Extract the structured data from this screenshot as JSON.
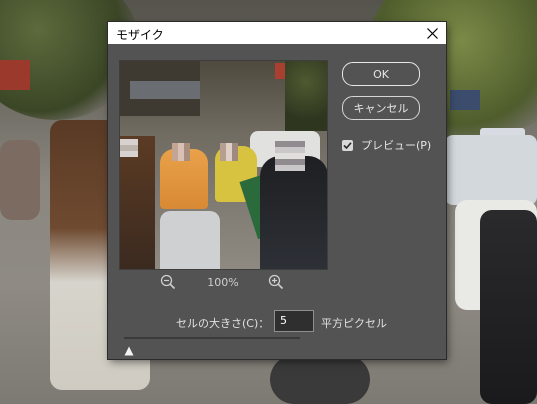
{
  "dialog": {
    "title": "モザイク",
    "buttons": {
      "ok": "OK",
      "cancel": "キャンセル"
    },
    "preview_checkbox": {
      "label": "プレビュー(P)",
      "checked": true
    },
    "zoom": {
      "percent": "100%"
    },
    "cell_size": {
      "label": "セルの大きさ(C)：",
      "value": "5",
      "unit": "平方ピクセル",
      "slider_level": 0.0
    }
  },
  "icons": {
    "close": "close-icon",
    "zoom_out": "zoom-out-icon",
    "zoom_in": "zoom-in-icon",
    "checkmark": "checkmark-icon"
  },
  "colors": {
    "dialog_bg": "#535353",
    "titlebar_bg": "#ffffff",
    "text": "#e6e6e6",
    "input_bg": "#2f2f2f"
  }
}
